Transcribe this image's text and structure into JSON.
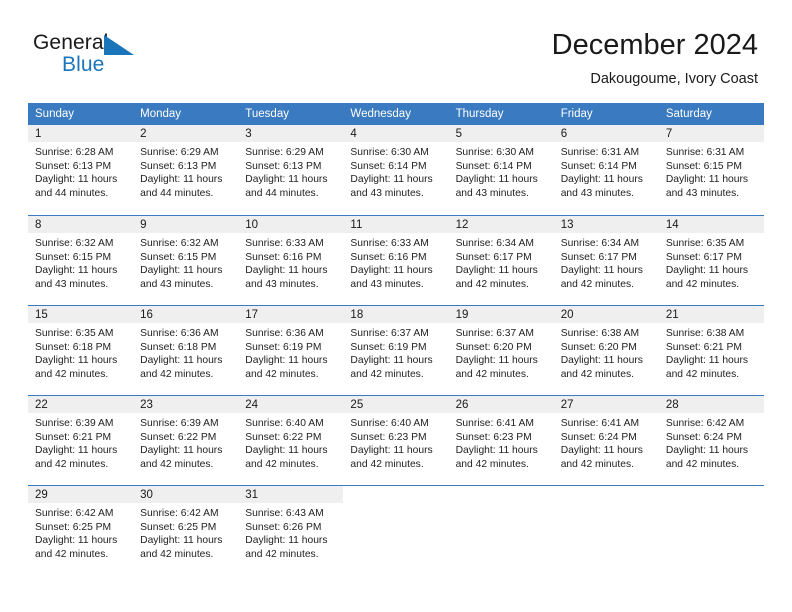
{
  "brand": {
    "name_part1": "General",
    "name_part2": "Blue",
    "flag_icon": "blue-triangle-flag-icon",
    "accent_color": "#1b75bb"
  },
  "header": {
    "title": "December 2024",
    "subtitle": "Dakougoume, Ivory Coast"
  },
  "theme": {
    "header_row_color": "#3a7ac0",
    "daynum_band_color": "#efefef",
    "text_color": "#1a1a1a"
  },
  "calendar": {
    "weekday_headers": [
      "Sunday",
      "Monday",
      "Tuesday",
      "Wednesday",
      "Thursday",
      "Friday",
      "Saturday"
    ],
    "weeks": [
      [
        {
          "day": "1",
          "sunrise": "Sunrise: 6:28 AM",
          "sunset": "Sunset: 6:13 PM",
          "daylight_line1": "Daylight: 11 hours",
          "daylight_line2": "and 44 minutes."
        },
        {
          "day": "2",
          "sunrise": "Sunrise: 6:29 AM",
          "sunset": "Sunset: 6:13 PM",
          "daylight_line1": "Daylight: 11 hours",
          "daylight_line2": "and 44 minutes."
        },
        {
          "day": "3",
          "sunrise": "Sunrise: 6:29 AM",
          "sunset": "Sunset: 6:13 PM",
          "daylight_line1": "Daylight: 11 hours",
          "daylight_line2": "and 44 minutes."
        },
        {
          "day": "4",
          "sunrise": "Sunrise: 6:30 AM",
          "sunset": "Sunset: 6:14 PM",
          "daylight_line1": "Daylight: 11 hours",
          "daylight_line2": "and 43 minutes."
        },
        {
          "day": "5",
          "sunrise": "Sunrise: 6:30 AM",
          "sunset": "Sunset: 6:14 PM",
          "daylight_line1": "Daylight: 11 hours",
          "daylight_line2": "and 43 minutes."
        },
        {
          "day": "6",
          "sunrise": "Sunrise: 6:31 AM",
          "sunset": "Sunset: 6:14 PM",
          "daylight_line1": "Daylight: 11 hours",
          "daylight_line2": "and 43 minutes."
        },
        {
          "day": "7",
          "sunrise": "Sunrise: 6:31 AM",
          "sunset": "Sunset: 6:15 PM",
          "daylight_line1": "Daylight: 11 hours",
          "daylight_line2": "and 43 minutes."
        }
      ],
      [
        {
          "day": "8",
          "sunrise": "Sunrise: 6:32 AM",
          "sunset": "Sunset: 6:15 PM",
          "daylight_line1": "Daylight: 11 hours",
          "daylight_line2": "and 43 minutes."
        },
        {
          "day": "9",
          "sunrise": "Sunrise: 6:32 AM",
          "sunset": "Sunset: 6:15 PM",
          "daylight_line1": "Daylight: 11 hours",
          "daylight_line2": "and 43 minutes."
        },
        {
          "day": "10",
          "sunrise": "Sunrise: 6:33 AM",
          "sunset": "Sunset: 6:16 PM",
          "daylight_line1": "Daylight: 11 hours",
          "daylight_line2": "and 43 minutes."
        },
        {
          "day": "11",
          "sunrise": "Sunrise: 6:33 AM",
          "sunset": "Sunset: 6:16 PM",
          "daylight_line1": "Daylight: 11 hours",
          "daylight_line2": "and 43 minutes."
        },
        {
          "day": "12",
          "sunrise": "Sunrise: 6:34 AM",
          "sunset": "Sunset: 6:17 PM",
          "daylight_line1": "Daylight: 11 hours",
          "daylight_line2": "and 42 minutes."
        },
        {
          "day": "13",
          "sunrise": "Sunrise: 6:34 AM",
          "sunset": "Sunset: 6:17 PM",
          "daylight_line1": "Daylight: 11 hours",
          "daylight_line2": "and 42 minutes."
        },
        {
          "day": "14",
          "sunrise": "Sunrise: 6:35 AM",
          "sunset": "Sunset: 6:17 PM",
          "daylight_line1": "Daylight: 11 hours",
          "daylight_line2": "and 42 minutes."
        }
      ],
      [
        {
          "day": "15",
          "sunrise": "Sunrise: 6:35 AM",
          "sunset": "Sunset: 6:18 PM",
          "daylight_line1": "Daylight: 11 hours",
          "daylight_line2": "and 42 minutes."
        },
        {
          "day": "16",
          "sunrise": "Sunrise: 6:36 AM",
          "sunset": "Sunset: 6:18 PM",
          "daylight_line1": "Daylight: 11 hours",
          "daylight_line2": "and 42 minutes."
        },
        {
          "day": "17",
          "sunrise": "Sunrise: 6:36 AM",
          "sunset": "Sunset: 6:19 PM",
          "daylight_line1": "Daylight: 11 hours",
          "daylight_line2": "and 42 minutes."
        },
        {
          "day": "18",
          "sunrise": "Sunrise: 6:37 AM",
          "sunset": "Sunset: 6:19 PM",
          "daylight_line1": "Daylight: 11 hours",
          "daylight_line2": "and 42 minutes."
        },
        {
          "day": "19",
          "sunrise": "Sunrise: 6:37 AM",
          "sunset": "Sunset: 6:20 PM",
          "daylight_line1": "Daylight: 11 hours",
          "daylight_line2": "and 42 minutes."
        },
        {
          "day": "20",
          "sunrise": "Sunrise: 6:38 AM",
          "sunset": "Sunset: 6:20 PM",
          "daylight_line1": "Daylight: 11 hours",
          "daylight_line2": "and 42 minutes."
        },
        {
          "day": "21",
          "sunrise": "Sunrise: 6:38 AM",
          "sunset": "Sunset: 6:21 PM",
          "daylight_line1": "Daylight: 11 hours",
          "daylight_line2": "and 42 minutes."
        }
      ],
      [
        {
          "day": "22",
          "sunrise": "Sunrise: 6:39 AM",
          "sunset": "Sunset: 6:21 PM",
          "daylight_line1": "Daylight: 11 hours",
          "daylight_line2": "and 42 minutes."
        },
        {
          "day": "23",
          "sunrise": "Sunrise: 6:39 AM",
          "sunset": "Sunset: 6:22 PM",
          "daylight_line1": "Daylight: 11 hours",
          "daylight_line2": "and 42 minutes."
        },
        {
          "day": "24",
          "sunrise": "Sunrise: 6:40 AM",
          "sunset": "Sunset: 6:22 PM",
          "daylight_line1": "Daylight: 11 hours",
          "daylight_line2": "and 42 minutes."
        },
        {
          "day": "25",
          "sunrise": "Sunrise: 6:40 AM",
          "sunset": "Sunset: 6:23 PM",
          "daylight_line1": "Daylight: 11 hours",
          "daylight_line2": "and 42 minutes."
        },
        {
          "day": "26",
          "sunrise": "Sunrise: 6:41 AM",
          "sunset": "Sunset: 6:23 PM",
          "daylight_line1": "Daylight: 11 hours",
          "daylight_line2": "and 42 minutes."
        },
        {
          "day": "27",
          "sunrise": "Sunrise: 6:41 AM",
          "sunset": "Sunset: 6:24 PM",
          "daylight_line1": "Daylight: 11 hours",
          "daylight_line2": "and 42 minutes."
        },
        {
          "day": "28",
          "sunrise": "Sunrise: 6:42 AM",
          "sunset": "Sunset: 6:24 PM",
          "daylight_line1": "Daylight: 11 hours",
          "daylight_line2": "and 42 minutes."
        }
      ],
      [
        {
          "day": "29",
          "sunrise": "Sunrise: 6:42 AM",
          "sunset": "Sunset: 6:25 PM",
          "daylight_line1": "Daylight: 11 hours",
          "daylight_line2": "and 42 minutes."
        },
        {
          "day": "30",
          "sunrise": "Sunrise: 6:42 AM",
          "sunset": "Sunset: 6:25 PM",
          "daylight_line1": "Daylight: 11 hours",
          "daylight_line2": "and 42 minutes."
        },
        {
          "day": "31",
          "sunrise": "Sunrise: 6:43 AM",
          "sunset": "Sunset: 6:26 PM",
          "daylight_line1": "Daylight: 11 hours",
          "daylight_line2": "and 42 minutes."
        },
        {
          "day": "",
          "sunrise": "",
          "sunset": "",
          "daylight_line1": "",
          "daylight_line2": ""
        },
        {
          "day": "",
          "sunrise": "",
          "sunset": "",
          "daylight_line1": "",
          "daylight_line2": ""
        },
        {
          "day": "",
          "sunrise": "",
          "sunset": "",
          "daylight_line1": "",
          "daylight_line2": ""
        },
        {
          "day": "",
          "sunrise": "",
          "sunset": "",
          "daylight_line1": "",
          "daylight_line2": ""
        }
      ]
    ]
  }
}
